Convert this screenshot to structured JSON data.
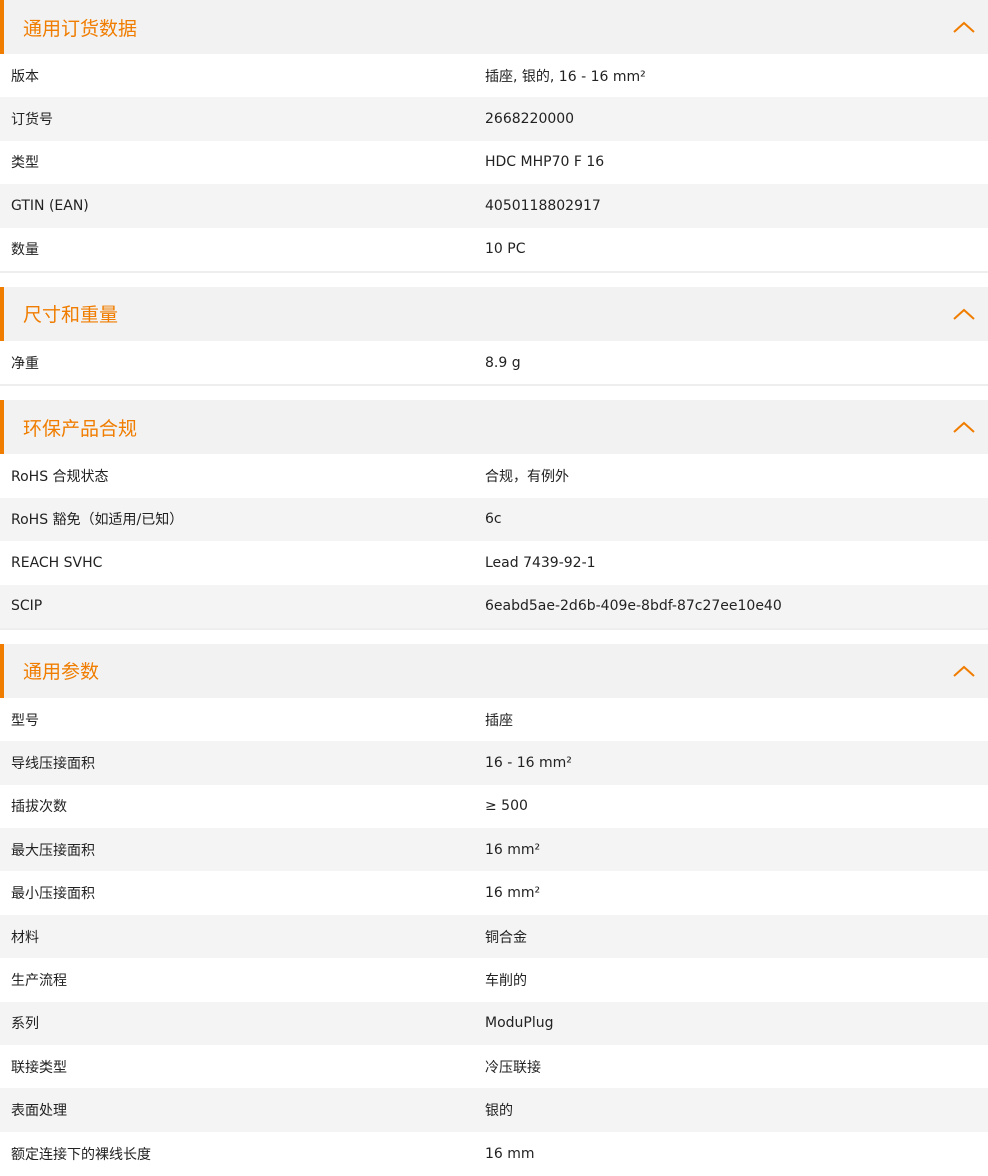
{
  "sections": [
    {
      "title": "通用订货数据",
      "rows": [
        {
          "label": "版本",
          "value": "插座, 银的, 16 - 16 mm²"
        },
        {
          "label": "订货号",
          "value": "2668220000"
        },
        {
          "label": "类型",
          "value": "HDC MHP70 F 16"
        },
        {
          "label": "GTIN (EAN)",
          "value": "4050118802917"
        },
        {
          "label": "数量",
          "value": "10  PC"
        }
      ]
    },
    {
      "title": "尺寸和重量",
      "rows": [
        {
          "label": "净重",
          "value": "8.9  g"
        }
      ]
    },
    {
      "title": "环保产品合规",
      "rows": [
        {
          "label": "RoHS 合规状态",
          "value": "合规，有例外"
        },
        {
          "label": "RoHS 豁免（如适用/已知）",
          "value": "6c"
        },
        {
          "label": "REACH SVHC",
          "value": "Lead 7439-92-1"
        },
        {
          "label": "SCIP",
          "value": "6eabd5ae-2d6b-409e-8bdf-87c27ee10e40"
        }
      ]
    },
    {
      "title": "通用参数",
      "rows": [
        {
          "label": "型号",
          "value": "插座"
        },
        {
          "label": "导线压接面积",
          "value": "16 - 16 mm²"
        },
        {
          "label": "插拔次数",
          "value": "≥ 500"
        },
        {
          "label": "最大压接面积",
          "value": "16  mm²"
        },
        {
          "label": "最小压接面积",
          "value": "16  mm²"
        },
        {
          "label": "材料",
          "value": "铜合金"
        },
        {
          "label": "生产流程",
          "value": "车削的"
        },
        {
          "label": "系列",
          "value": "ModuPlug"
        },
        {
          "label": "联接类型",
          "value": "冷压联接"
        },
        {
          "label": "表面处理",
          "value": "银的"
        },
        {
          "label": "额定连接下的裸线长度",
          "value": "16  mm"
        }
      ]
    }
  ],
  "icons": {
    "collapse": "chevron-up-icon"
  },
  "colors": {
    "accent": "#f07d00",
    "row_alt": "#f4f4f4",
    "header_bg": "#f2f2f2"
  }
}
